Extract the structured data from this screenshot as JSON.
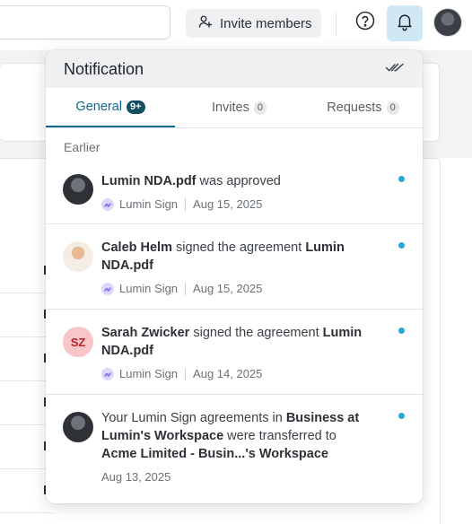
{
  "topbar": {
    "invite_label": "Invite members"
  },
  "notification": {
    "title": "Notification",
    "tabs": [
      {
        "label": "General",
        "badge": "9+"
      },
      {
        "label": "Invites",
        "badge": "0"
      },
      {
        "label": "Requests",
        "badge": "0"
      }
    ],
    "section": "Earlier",
    "items": [
      {
        "bold1": "Lumin NDA.pdf",
        "text1": " was approved",
        "bold2": "",
        "text2": "",
        "bold3": "",
        "text3": "",
        "app": "Lumin Sign",
        "date": "Aug 15, 2025",
        "avatar_initials": ""
      },
      {
        "bold1": "Caleb Helm",
        "text1": " signed the agreement ",
        "bold2": "Lumin NDA.pdf",
        "text2": "",
        "bold3": "",
        "text3": "",
        "app": "Lumin Sign",
        "date": "Aug 15, 2025",
        "avatar_initials": ""
      },
      {
        "bold1": "Sarah Zwicker",
        "text1": " signed the agreement ",
        "bold2": "Lumin NDA.pdf",
        "text2": "",
        "bold3": "",
        "text3": "",
        "app": "Lumin Sign",
        "date": "Aug 14, 2025",
        "avatar_initials": "SZ"
      },
      {
        "bold1": "",
        "text1": "Your Lumin Sign agreements in ",
        "bold2": "Business at Lumin's Workspace",
        "text2": " were transferred to ",
        "bold3": "Acme Limited - Busin...'s Workspace",
        "text3": "",
        "app": "",
        "date": "Aug 13, 2025",
        "avatar_initials": ""
      }
    ]
  },
  "colors": {
    "accent": "#0b6b8f",
    "unread_dot": "#2aa7d6",
    "bell_active_bg": "#cfe8f4",
    "badge_dark": "#104f63"
  },
  "icons": {
    "invite": "user-plus-icon",
    "help": "question-circle-icon",
    "bell": "bell-icon",
    "mark_all_read": "double-check-icon",
    "app": "lumin-sign-icon"
  }
}
